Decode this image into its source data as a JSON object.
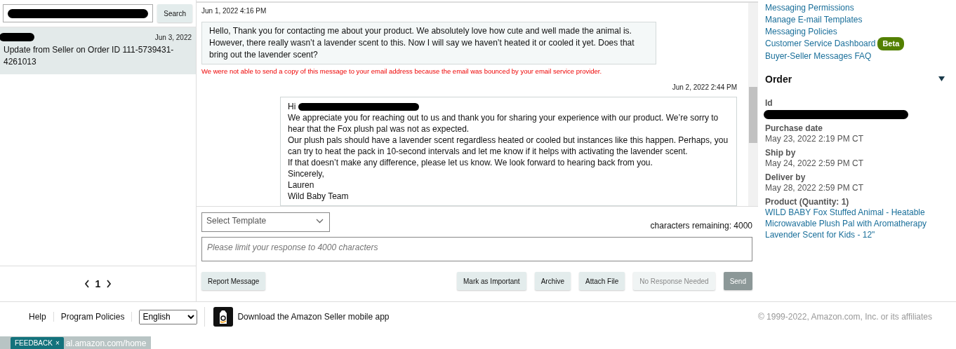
{
  "search": {
    "button": "Search"
  },
  "threads": [
    {
      "date": "Jun 3, 2022",
      "subject": "Update from Seller on Order ID 111-5739431-4261013",
      "selected": true
    }
  ],
  "pagination": {
    "page": "1"
  },
  "messages": [
    {
      "kind": "received",
      "timestamp": "Jun 1, 2022 4:16 PM",
      "lines": [
        "Hello, Thank you for contacting me about your product. We absolutely love how cute and well made the animal is. However, there really wasn’t a lavender scent to this. Now I will say we haven’t heated it or cooled it yet. Does that bring out the lavender scent?"
      ],
      "error": "We were not able to send a copy of this message to your email address because the email was bounced by your email service provider."
    },
    {
      "kind": "sent",
      "timestamp": "Jun 2, 2022 2:44 PM",
      "greeting": "Hi",
      "lines": [
        "We appreciate you for reaching out to us and thank you for sharing your experience with our product. We’re sorry to hear that the Fox plush pal was not as expected.",
        "Our plush pals should have a lavender scent regardless heated or cooled but instances like this happen. Perhaps, you can try to heat the pack in 10-second intervals and let me know if it helps with activating the lavender scent.",
        "If that doesn’t make any difference, please let us know. We look forward to hearing back from you.",
        "Sincerely,",
        "Lauren",
        "Wild Baby Team"
      ]
    }
  ],
  "composer": {
    "template_select": "Select Template",
    "chars_remaining": "characters remaining: 4000",
    "placeholder": "Please limit your response to 4000 characters",
    "left_buttons": [
      {
        "label": "Report Message",
        "kind": "secondary",
        "disabled": false
      }
    ],
    "right_buttons": [
      {
        "label": "Mark as Important",
        "kind": "secondary",
        "disabled": false
      },
      {
        "label": "Archive",
        "kind": "secondary",
        "disabled": false
      },
      {
        "label": "Attach File",
        "kind": "secondary",
        "disabled": false
      },
      {
        "label": "No Response Needed",
        "kind": "secondary",
        "disabled": true
      },
      {
        "label": "Send",
        "kind": "primary",
        "disabled": true
      }
    ]
  },
  "sidebar": {
    "links": [
      {
        "label": "Messaging Permissions"
      },
      {
        "label": "Manage E-mail Templates"
      },
      {
        "label": "Messaging Policies"
      },
      {
        "label": "Customer Service Dashboard",
        "badge": "Beta"
      },
      {
        "label": "Buyer-Seller Messages FAQ"
      }
    ],
    "order": {
      "title": "Order",
      "expanded": true,
      "fields": [
        {
          "label": "Id",
          "kind": "redacted"
        },
        {
          "label": "Purchase date",
          "value": "May 23, 2022 2:19 PM CT",
          "kind": "text"
        },
        {
          "label": "Ship by",
          "value": "May 24, 2022 2:59 PM CT",
          "kind": "text"
        },
        {
          "label": "Deliver by",
          "value": "May 28, 2022 2:59 PM CT",
          "kind": "text"
        },
        {
          "label": "Product (Quantity: 1)",
          "value": "WILD BABY Fox Stuffed Animal - Heatable Microwavable Plush Pal with Aromatherapy Lavender Scent for Kids - 12\"",
          "kind": "link"
        }
      ]
    }
  },
  "footer": {
    "links": [
      "Help",
      "Program Policies"
    ],
    "language": "English",
    "app_text": "Download the Amazon Seller mobile app",
    "copyright": "© 1999-2022, Amazon.com, Inc. or its affiliates"
  },
  "status_bar": {
    "feedback": "FEEDBACK",
    "close": "×",
    "url": "al.amazon.com/home"
  }
}
